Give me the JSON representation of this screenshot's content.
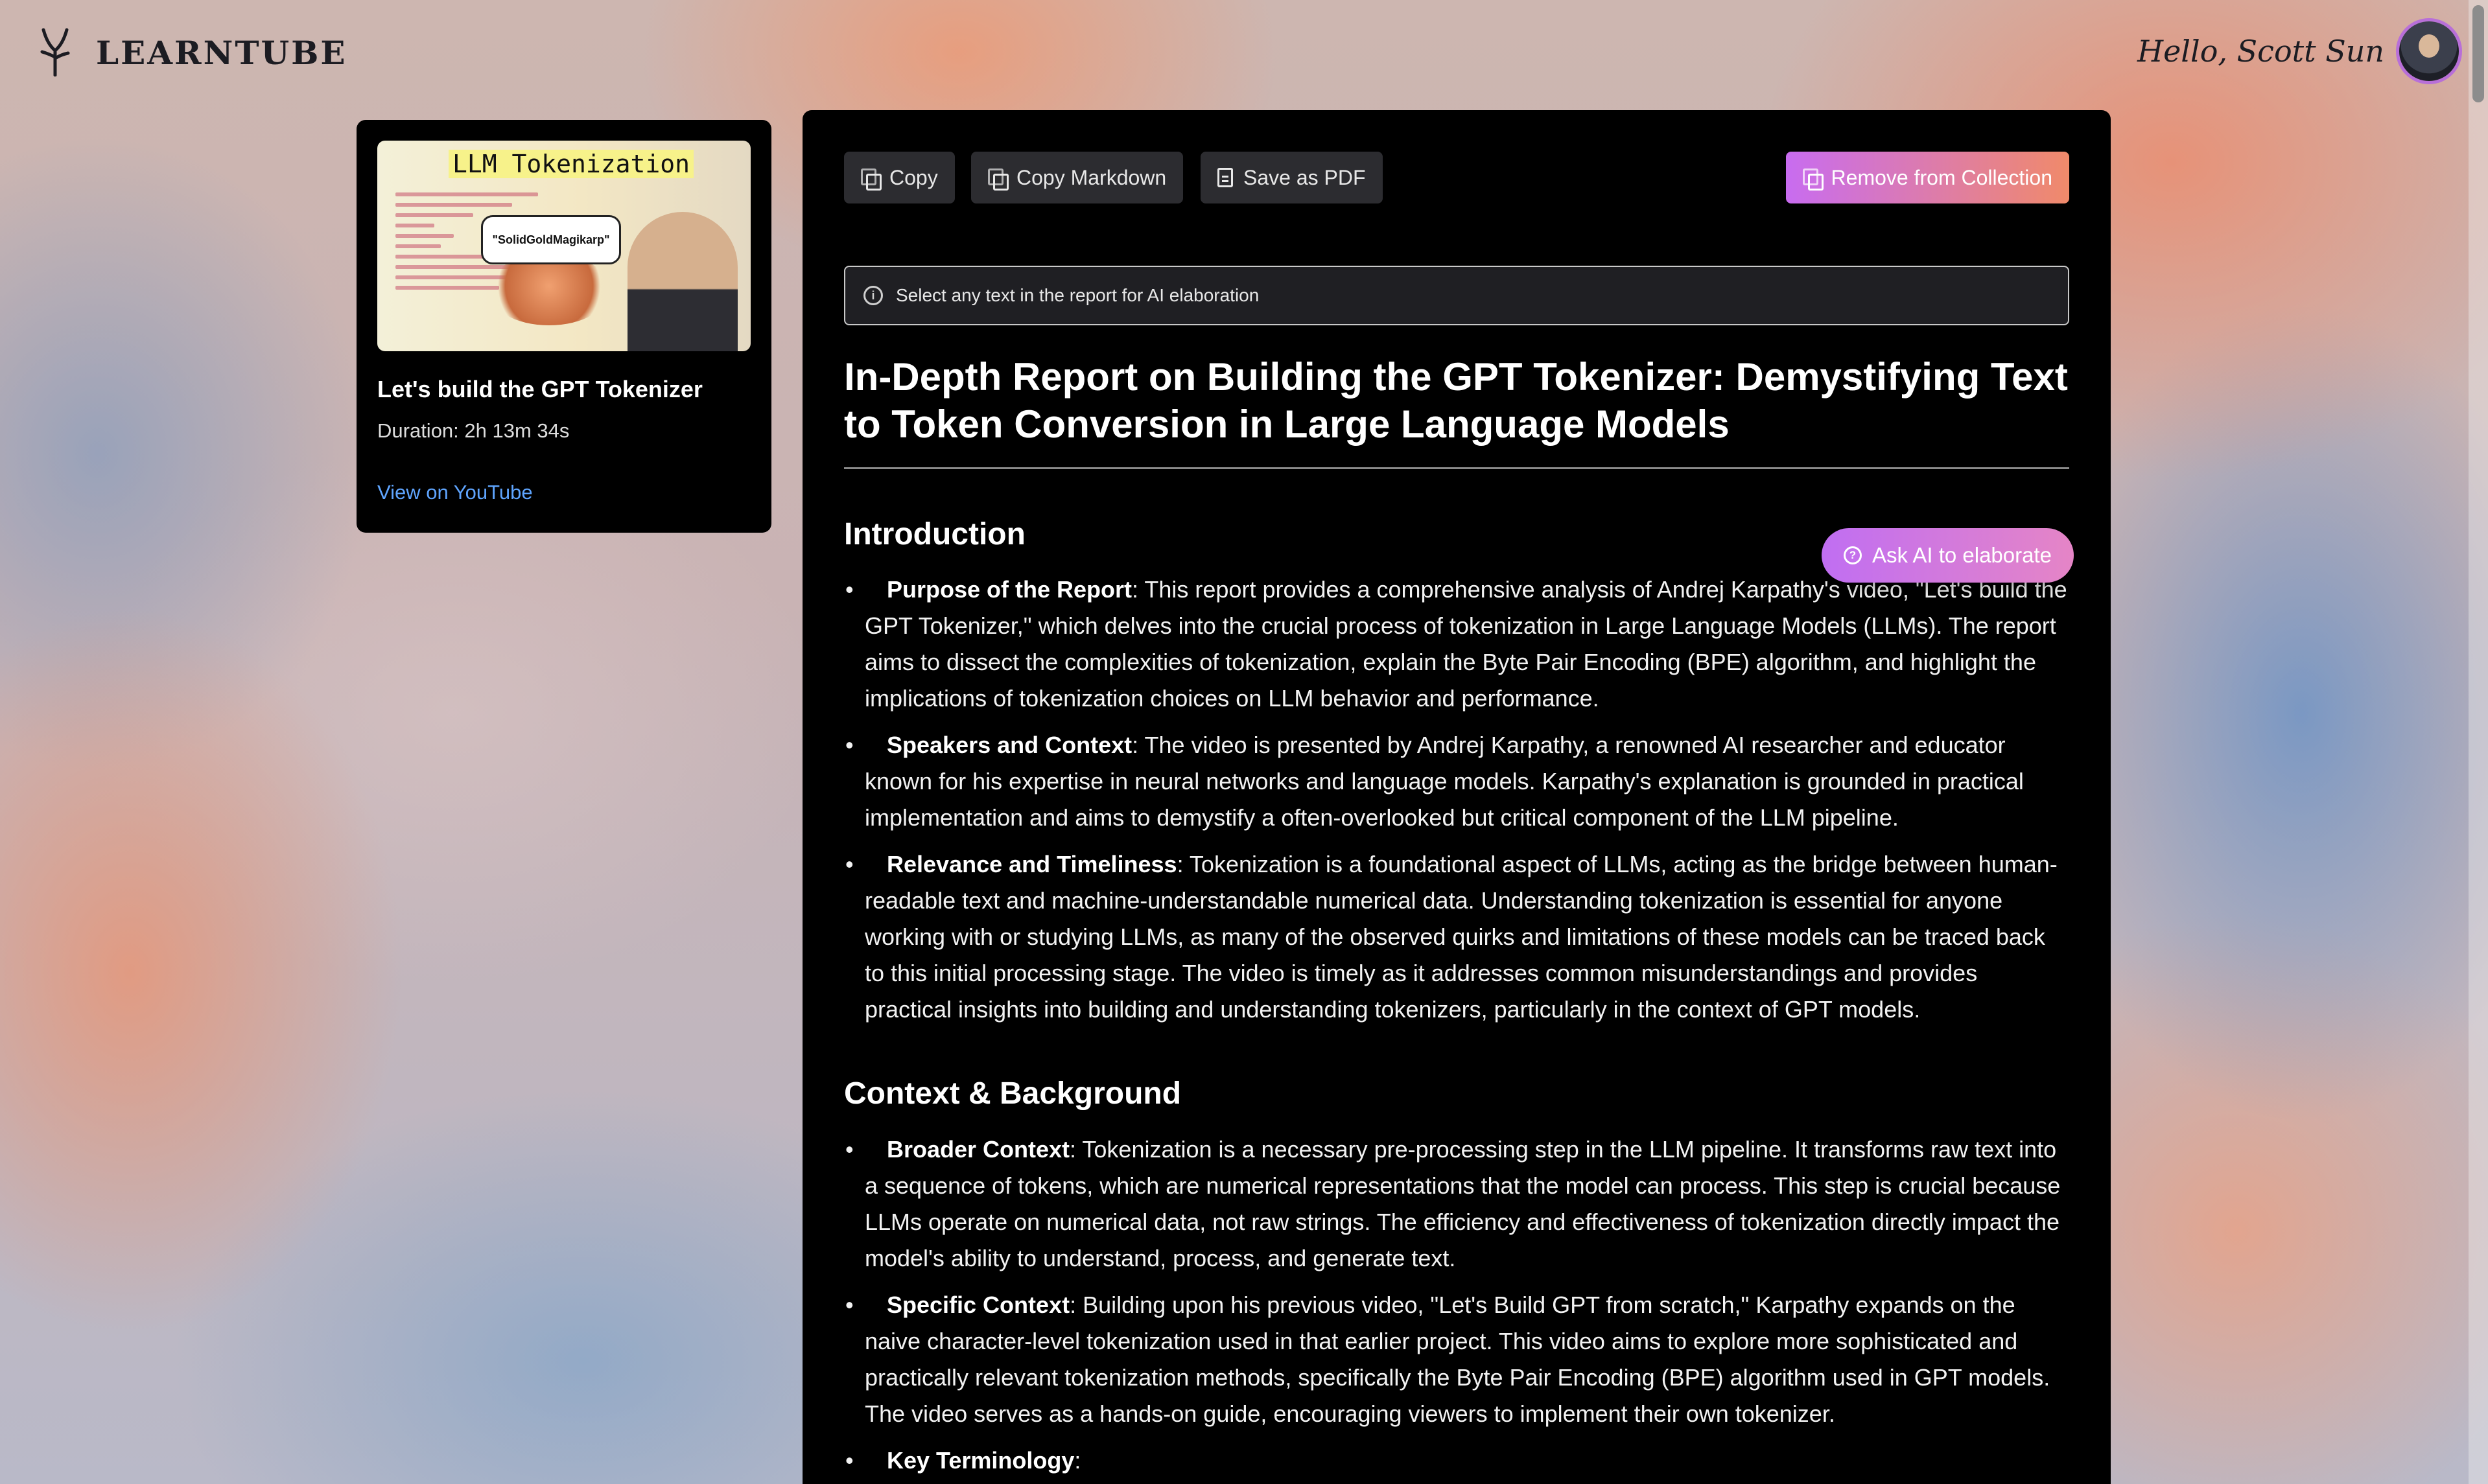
{
  "header": {
    "logo_text": "LEARNTUBE",
    "greeting": "Hello, Scott Sun"
  },
  "video": {
    "thumbnail_title": "LLM Tokenization",
    "thumbnail_bubble": "\"SolidGoldMagikarp\"",
    "title": "Let's build the GPT Tokenizer",
    "duration": "Duration: 2h 13m 34s",
    "link": "View on YouTube"
  },
  "toolbar": {
    "copy": "Copy",
    "copy_markdown": "Copy Markdown",
    "save_pdf": "Save as PDF",
    "remove": "Remove from Collection"
  },
  "info": {
    "text": "Select any text in the report for AI elaboration"
  },
  "ask_ai": "Ask AI to elaborate",
  "report": {
    "title": "In-Depth Report on Building the GPT Tokenizer: Demystifying Text to Token Conversion in Large Language Models",
    "sections": [
      {
        "heading": "Introduction",
        "items": [
          {
            "label": "Purpose of the Report",
            "text": ": This report provides a comprehensive analysis of Andrej Karpathy's video, \"Let's build the GPT Tokenizer,\" which delves into the crucial process of tokenization in Large Language Models (LLMs). The report aims to dissect the complexities of tokenization, explain the Byte Pair Encoding (BPE) algorithm, and highlight the implications of tokenization choices on LLM behavior and performance."
          },
          {
            "label": "Speakers and Context",
            "text": ": The video is presented by Andrej Karpathy, a renowned AI researcher and educator known for his expertise in neural networks and language models. Karpathy's explanation is grounded in practical implementation and aims to demystify a often-overlooked but critical component of the LLM pipeline."
          },
          {
            "label": "Relevance and Timeliness",
            "text": ": Tokenization is a foundational aspect of LLMs, acting as the bridge between human-readable text and machine-understandable numerical data. Understanding tokenization is essential for anyone working with or studying LLMs, as many of the observed quirks and limitations of these models can be traced back to this initial processing stage. The video is timely as it addresses common misunderstandings and provides practical insights into building and understanding tokenizers, particularly in the context of GPT models."
          }
        ]
      },
      {
        "heading": "Context & Background",
        "items": [
          {
            "label": "Broader Context",
            "text": ": Tokenization is a necessary pre-processing step in the LLM pipeline. It transforms raw text into a sequence of tokens, which are numerical representations that the model can process. This step is crucial because LLMs operate on numerical data, not raw strings. The efficiency and effectiveness of tokenization directly impact the model's ability to understand, process, and generate text."
          },
          {
            "label": "Specific Context",
            "text": ": Building upon his previous video, \"Let's Build GPT from scratch,\" Karpathy expands on the naive character-level tokenization used in that earlier project. This video aims to explore more sophisticated and practically relevant tokenization methods, specifically the Byte Pair Encoding (BPE) algorithm used in GPT models. The video serves as a hands-on guide, encouraging viewers to implement their own tokenizer."
          },
          {
            "label": "Key Terminology",
            "text": ":"
          }
        ]
      }
    ]
  },
  "colors": {
    "panel_bg": "#000000",
    "link": "#5fa5ff",
    "accent_gradient_start": "#c86cf0",
    "accent_gradient_end": "#f08a6a"
  },
  "icons": [
    "logo-sprout-icon",
    "avatar",
    "copy-icon",
    "document-icon",
    "collection-icon",
    "info-icon",
    "help-circle-icon"
  ]
}
